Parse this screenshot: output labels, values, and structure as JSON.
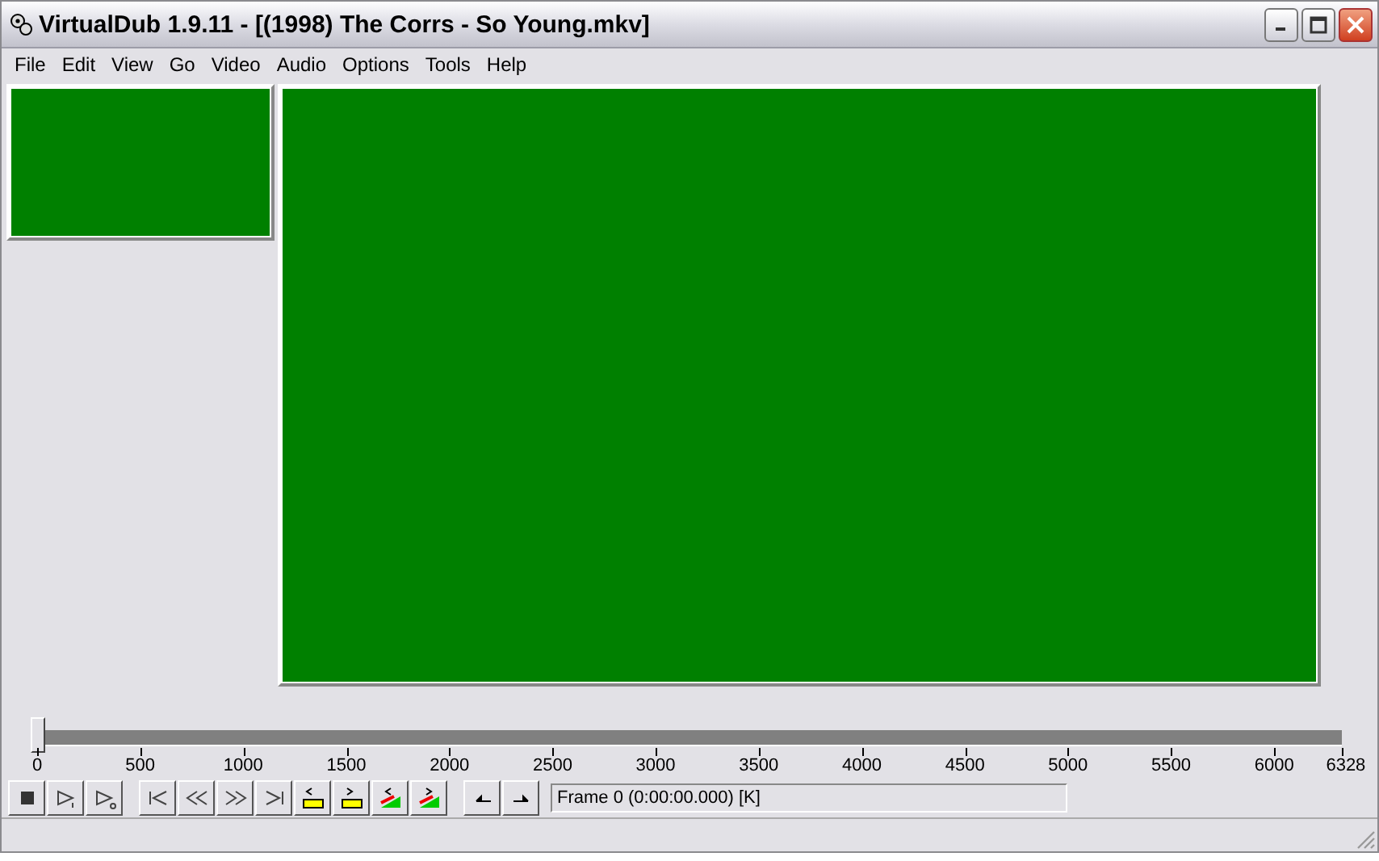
{
  "window": {
    "title": "VirtualDub 1.9.11 - [(1998) The Corrs - So Young.mkv]"
  },
  "menu": [
    "File",
    "Edit",
    "View",
    "Go",
    "Video",
    "Audio",
    "Options",
    "Tools",
    "Help"
  ],
  "position_slider": {
    "level": 0,
    "ticks": [
      "0",
      "500",
      "1000",
      "1500",
      "2000",
      "2500",
      "3000",
      "3500",
      "4000",
      "4500",
      "5000",
      "5500",
      "6000",
      "6328"
    ]
  },
  "frame_status": "Frame 0 (0:00:00.000) [K]"
}
